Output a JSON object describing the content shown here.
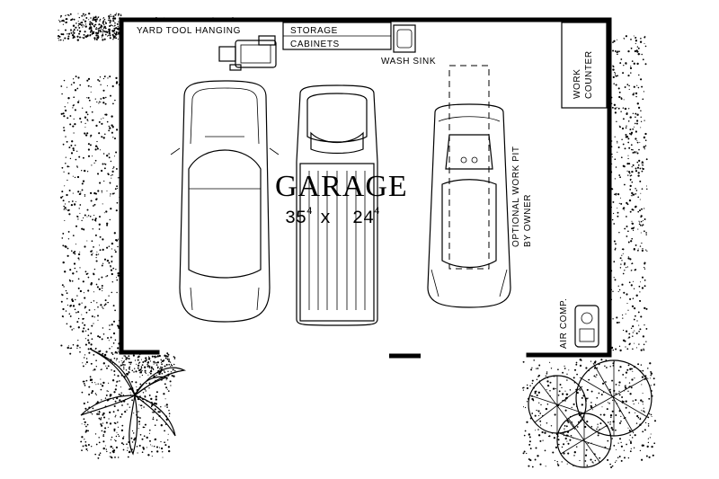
{
  "plan": {
    "room_name": "GARAGE",
    "dimension": {
      "width_ft": "35",
      "width_in": "4",
      "separator": "x",
      "depth_ft": "24",
      "depth_in": "4"
    },
    "labels": {
      "yard_tool_hanging": "YARD TOOL HANGING",
      "storage": "STORAGE",
      "cabinets": "CABINETS",
      "wash_sink": "WASH SINK",
      "work_counter_line1": "WORK",
      "work_counter_line2": "COUNTER",
      "work_pit_line1": "OPTIONAL WORK PIT",
      "work_pit_line2": "BY OWNER",
      "air_comp": "AIR COMP."
    }
  },
  "icons": [
    "lawn-mower-icon",
    "car-icon",
    "pickup-truck-icon",
    "sports-car-icon",
    "air-compressor-icon",
    "palm-plant-icon",
    "round-shrub-icon"
  ],
  "colors": {
    "ink": "#000000",
    "paper": "#ffffff"
  }
}
